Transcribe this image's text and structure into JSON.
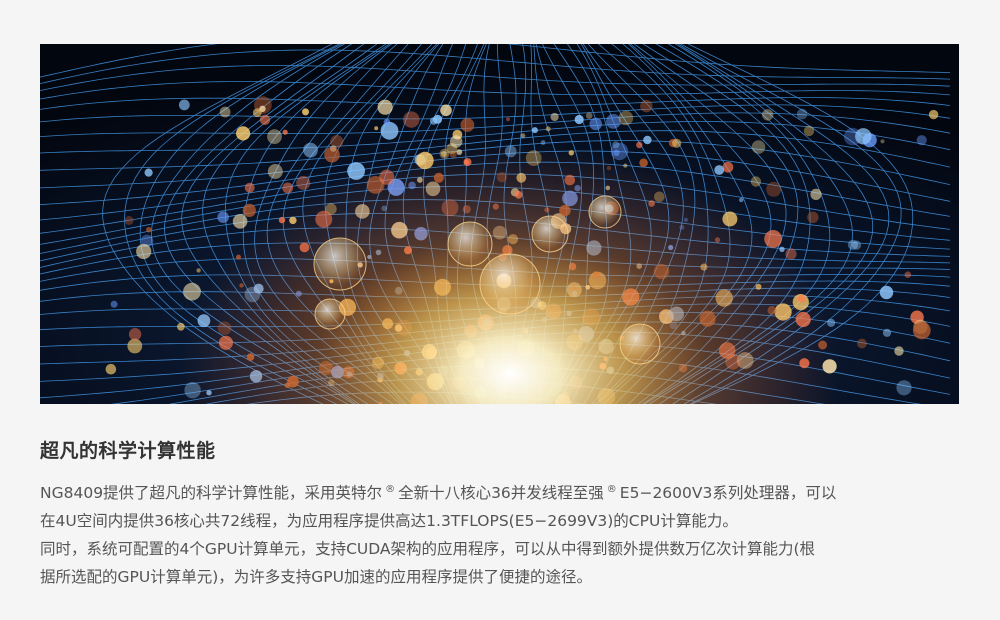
{
  "hero": {
    "image": "ai-brain-wireframe-head-with-glowing-particles"
  },
  "section": {
    "title": "超凡的科学计算性能",
    "para1": {
      "t1": "NG8409提供了超凡的科学计算性能，采用英特尔",
      "reg": "®",
      "t2": "全新十八核心36并发线程至强",
      "t3": "E5−2600V3系列处理器，可以",
      "line2": "在4U空间内提供36核心共72线程，为应用程序提供高达1.3TFLOPS(E5−2699V3)的CPU计算能力。"
    },
    "para2": {
      "line1": "同时，系统可配置的4个GPU计算单元，支持CUDA架构的应用程序，可以从中得到额外提供数万亿次计算能力(根",
      "line2": "据所选配的GPU计算单元)，为许多支持GPU加速的应用程序提供了便捷的途径。"
    }
  },
  "colors": {
    "background": "#f5f5f5",
    "title": "#333333",
    "body_text": "#555555",
    "mesh": "#3aa0ff",
    "glow": "#ffe9a8"
  }
}
